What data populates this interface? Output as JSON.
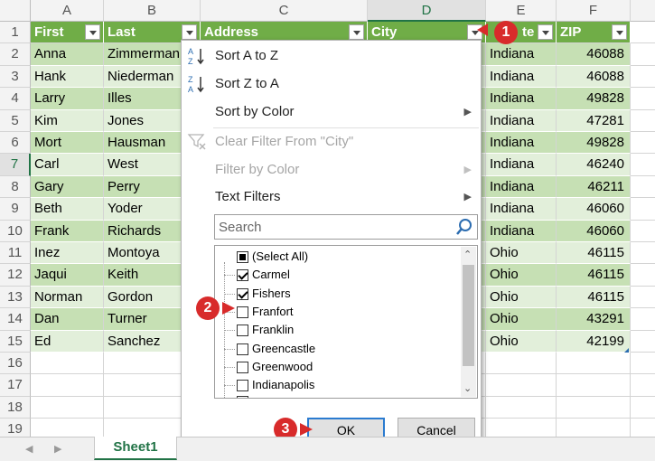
{
  "columns": [
    "A",
    "B",
    "C",
    "D",
    "E",
    "F"
  ],
  "rows": [
    "1",
    "2",
    "3",
    "4",
    "5",
    "6",
    "7",
    "8",
    "9",
    "10",
    "11",
    "12",
    "13",
    "14",
    "15",
    "16",
    "17",
    "18",
    "19"
  ],
  "headers": {
    "first": "First",
    "last": "Last",
    "address": "Address",
    "city": "City",
    "state": "te",
    "zip": "ZIP"
  },
  "data": [
    {
      "first": "Anna",
      "last": "Zimmerman",
      "state": "Indiana",
      "zip": "46088"
    },
    {
      "first": "Hank",
      "last": "Niederman",
      "state": "Indiana",
      "zip": "46088"
    },
    {
      "first": "Larry",
      "last": "Illes",
      "state": "Indiana",
      "zip": "49828"
    },
    {
      "first": "Kim",
      "last": "Jones",
      "state": "Indiana",
      "zip": "47281"
    },
    {
      "first": "Mort",
      "last": "Hausman",
      "state": "Indiana",
      "zip": "49828"
    },
    {
      "first": "Carl",
      "last": "West",
      "state": "Indiana",
      "zip": "46240"
    },
    {
      "first": "Gary",
      "last": "Perry",
      "state": "Indiana",
      "zip": "46211"
    },
    {
      "first": "Beth",
      "last": "Yoder",
      "state": "Indiana",
      "zip": "46060"
    },
    {
      "first": "Frank",
      "last": "Richards",
      "state": "Indiana",
      "zip": "46060"
    },
    {
      "first": "Inez",
      "last": "Montoya",
      "state": "Ohio",
      "zip": "46115"
    },
    {
      "first": "Jaqui",
      "last": "Keith",
      "state": "Ohio",
      "zip": "46115"
    },
    {
      "first": "Norman",
      "last": "Gordon",
      "state": "Ohio",
      "zip": "46115"
    },
    {
      "first": "Dan",
      "last": "Turner",
      "state": "Ohio",
      "zip": "43291"
    },
    {
      "first": "Ed",
      "last": "Sanchez",
      "state": "Ohio",
      "zip": "42199"
    }
  ],
  "menu": {
    "sort_az": "Sort A to Z",
    "sort_za": "Sort Z to A",
    "sort_color": "Sort by Color",
    "clear_filter": "Clear Filter From \"City\"",
    "filter_color": "Filter by Color",
    "text_filters": "Text Filters",
    "search_placeholder": "Search",
    "ok": "OK",
    "cancel": "Cancel"
  },
  "filter_items": [
    {
      "label": "(Select All)",
      "state": "partial"
    },
    {
      "label": "Carmel",
      "state": "checked"
    },
    {
      "label": "Fishers",
      "state": "checked"
    },
    {
      "label": "Franfort",
      "state": "unchecked"
    },
    {
      "label": "Franklin",
      "state": "unchecked"
    },
    {
      "label": "Greencastle",
      "state": "unchecked"
    },
    {
      "label": "Greenwood",
      "state": "unchecked"
    },
    {
      "label": "Indianapolis",
      "state": "unchecked"
    }
  ],
  "sheet_tab": "Sheet1",
  "callouts": [
    "1",
    "2",
    "3"
  ],
  "colors": {
    "header_green": "#70ad47",
    "band_dark": "#c6e0b4",
    "band_light": "#e2efda",
    "callout_red": "#d82b2b",
    "excel_green": "#217346"
  }
}
